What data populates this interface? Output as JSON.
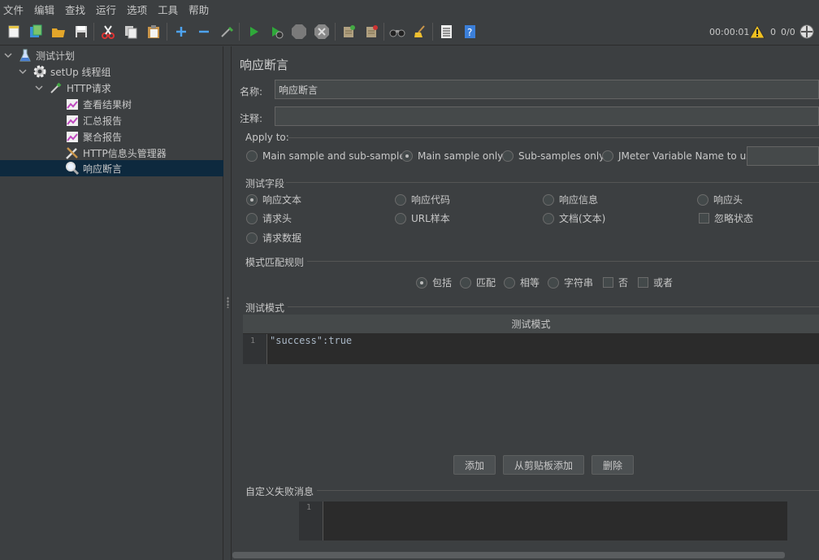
{
  "menu": [
    "文件",
    "编辑",
    "查找",
    "运行",
    "选项",
    "工具",
    "帮助"
  ],
  "status": {
    "timer": "00:00:01",
    "warnings": "0",
    "threads": "0/0"
  },
  "tree": [
    {
      "label": "测试计划",
      "icon": "flask-icon",
      "depth": 0,
      "expanded": true
    },
    {
      "label": "setUp 线程组",
      "icon": "gear-icon",
      "depth": 1,
      "expanded": true
    },
    {
      "label": "HTTP请求",
      "icon": "pipette-icon",
      "depth": 2,
      "expanded": true
    },
    {
      "label": "查看结果树",
      "icon": "chart-icon",
      "depth": 3
    },
    {
      "label": "汇总报告",
      "icon": "chart-icon",
      "depth": 3
    },
    {
      "label": "聚合报告",
      "icon": "chart-icon",
      "depth": 3
    },
    {
      "label": "HTTP信息头管理器",
      "icon": "tools-icon",
      "depth": 3
    },
    {
      "label": "响应断言",
      "icon": "magnifier-icon",
      "depth": 3,
      "selected": true
    }
  ],
  "panel": {
    "title": "响应断言",
    "name_label": "名称:",
    "name_value": "响应断言",
    "comment_label": "注释:",
    "comment_value": "",
    "apply_to": {
      "title": "Apply to:",
      "options": [
        "Main sample and sub-samples",
        "Main sample only",
        "Sub-samples only",
        "JMeter Variable Name to use"
      ],
      "selected": "Main sample only",
      "variable_value": ""
    },
    "field_to_test": {
      "title": "测试字段",
      "options": [
        "响应文本",
        "响应代码",
        "响应信息",
        "响应头",
        "请求头",
        "URL样本",
        "文档(文本)",
        "请求数据"
      ],
      "selected": "响应文本",
      "ignore_status_label": "忽略状态",
      "ignore_status": false
    },
    "pattern_matching": {
      "title": "模式匹配规则",
      "options": [
        "包括",
        "匹配",
        "相等",
        "字符串"
      ],
      "selected": "包括",
      "not_label": "否",
      "not": false,
      "or_label": "或者",
      "or": false
    },
    "patterns": {
      "title": "测试模式",
      "column_header": "测试模式",
      "line_number": "1",
      "rows": [
        "\"success\":true"
      ]
    },
    "buttons": {
      "add": "添加",
      "add_from_clipboard": "从剪贴板添加",
      "delete": "删除"
    },
    "failure_message": {
      "title": "自定义失败消息",
      "line_number": "1",
      "value": ""
    }
  },
  "colors": {
    "background": "#3c3f41",
    "selection": "#0d293e",
    "editor": "#2b2b2b",
    "play": "#2fa83a"
  }
}
